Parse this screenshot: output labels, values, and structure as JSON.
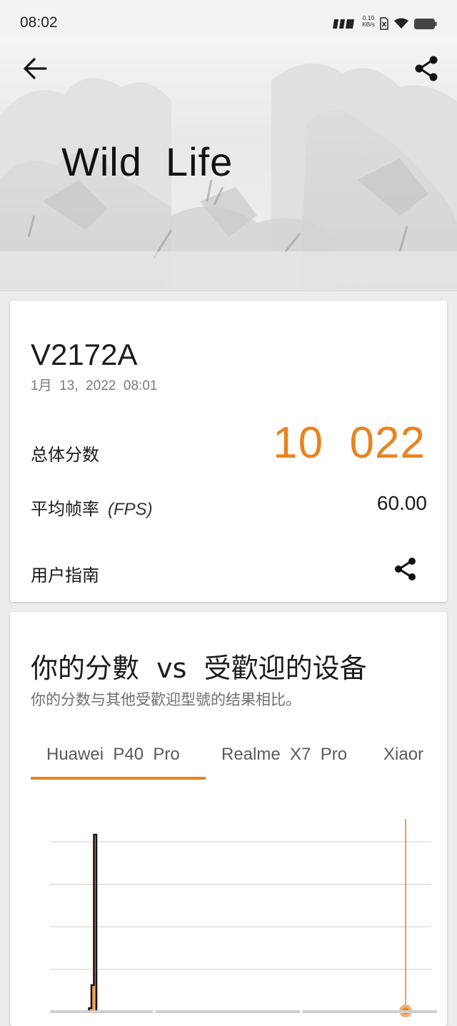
{
  "status_bar": {
    "time": "08:02",
    "net_speed_value": "0.10",
    "net_speed_unit": "KB/s",
    "icons": [
      "signal-icon",
      "sim-icon",
      "wifi-icon",
      "battery-icon"
    ]
  },
  "hero": {
    "title": "Wild  Life",
    "back_icon": "arrow-left-icon",
    "share_icon": "share-icon"
  },
  "result": {
    "device": "V2172A",
    "date": "1月  13,  2022  08:01",
    "overall_label": "总体分数",
    "overall_score": "10  022",
    "fps_label": "平均帧率",
    "fps_unit": "(FPS)",
    "fps_value": "60.00",
    "guide_label": "用户指南",
    "share_icon": "share-icon"
  },
  "comparison": {
    "title": "你的分數  vs  受歡迎的设备",
    "subtitle": "你的分数与其他受歡迎型號的结果相比。",
    "tabs": [
      {
        "label": "Huawei  P40  Pro",
        "selected": true
      },
      {
        "label": "Realme  X7  Pro",
        "selected": false
      },
      {
        "label": "Xiaor",
        "selected": false
      }
    ]
  },
  "colors": {
    "accent": "#e9831e",
    "background": "#ececec",
    "card": "#ffffff"
  },
  "chart_data": {
    "type": "area",
    "description_series": "score distribution histogram",
    "x_position_of_your_score": "far right",
    "peak_position": "near left",
    "series": [
      {
        "values": [
          0,
          0,
          0,
          0.02,
          0.15,
          1.0,
          0,
          0,
          0,
          0,
          0,
          0,
          0,
          0,
          0,
          0,
          0,
          0,
          0,
          0,
          0,
          0,
          0,
          0,
          0,
          0,
          0,
          0,
          0,
          0,
          0,
          0,
          0,
          0,
          0,
          0,
          0,
          0,
          0,
          0
        ]
      }
    ],
    "gridlines": 4,
    "marker": "your score"
  }
}
